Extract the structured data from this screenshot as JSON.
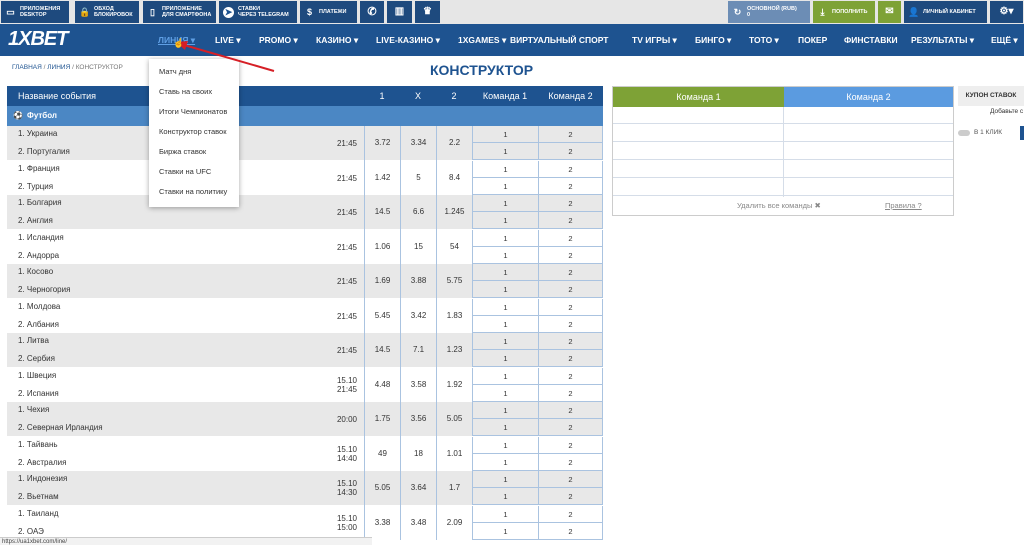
{
  "topbar": {
    "items": [
      {
        "label1": "ПРИЛОЖЕНИЯ",
        "label2": "DESKTOP",
        "icon": "monitor-icon"
      },
      {
        "label1": "ОБХОД",
        "label2": "БЛОКИРОВОК",
        "icon": "lock-icon"
      },
      {
        "label1": "ПРИЛОЖЕНИЕ",
        "label2": "ДЛЯ СМАРТФОНА",
        "icon": "phone-icon"
      },
      {
        "label1": "СТАВКИ",
        "label2": "ЧЕРЕЗ TELEGRAM",
        "icon": "telegram-icon"
      },
      {
        "label1": "ПЛАТЕЖИ",
        "label2": "",
        "icon": "dollar-icon"
      }
    ],
    "account_label": "ОСНОВНОЙ (RUB)",
    "account_value": "0",
    "deposit": "ПОПОЛНИТЬ",
    "cabinet": "ЛИЧНЫЙ КАБИНЕТ"
  },
  "nav": {
    "logo": "1XBET",
    "items": [
      "ЛИНИЯ",
      "LIVE",
      "PROMO",
      "КАЗИНО",
      "LIVE-КАЗИНО",
      "1XGAMES",
      "ВИРТУАЛЬНЫЙ СПОРТ",
      "TV ИГРЫ",
      "БИНГО",
      "ТОТО",
      "ПОКЕР",
      "ФИНСТАВКИ",
      "РЕЗУЛЬТАТЫ",
      "ЕЩЁ"
    ]
  },
  "breadcrumb": {
    "home": "ГЛАВНАЯ",
    "line": "ЛИНИЯ",
    "current": "КОНСТРУКТОР",
    "sep": "/"
  },
  "page_title": "КОНСТРУКТОР",
  "dropdown": [
    "Матч дня",
    "Ставь на своих",
    "Итоги Чемпионатов",
    "Конструктор ставок",
    "Биржа ставок",
    "Ставки на UFC",
    "Ставки на политику"
  ],
  "table": {
    "headers": [
      "Название события",
      "1",
      "X",
      "2",
      "Команда 1",
      "Команда 2"
    ],
    "sport": "Футбол",
    "rows": [
      {
        "t1": "1. Украина",
        "t2": "2. Португалия",
        "time": "21:45",
        "o1": "3.72",
        "x": "3.34",
        "o2": "2.2"
      },
      {
        "t1": "1. Франция",
        "t2": "2. Турция",
        "time": "21:45",
        "o1": "1.42",
        "x": "5",
        "o2": "8.4"
      },
      {
        "t1": "1. Болгария",
        "t2": "2. Англия",
        "time": "21:45",
        "o1": "14.5",
        "x": "6.6",
        "o2": "1.245"
      },
      {
        "t1": "1. Исландия",
        "t2": "2. Андорра",
        "time": "21:45",
        "o1": "1.06",
        "x": "15",
        "o2": "54"
      },
      {
        "t1": "1. Косово",
        "t2": "2. Черногория",
        "time": "21:45",
        "o1": "1.69",
        "x": "3.88",
        "o2": "5.75"
      },
      {
        "t1": "1. Молдова",
        "t2": "2. Албания",
        "time": "21:45",
        "o1": "5.45",
        "x": "3.42",
        "o2": "1.83"
      },
      {
        "t1": "1. Литва",
        "t2": "2. Сербия",
        "time": "21:45",
        "o1": "14.5",
        "x": "7.1",
        "o2": "1.23"
      },
      {
        "t1": "1. Швеция",
        "t2": "2. Испания",
        "time": "15.10 21:45",
        "o1": "4.48",
        "x": "3.58",
        "o2": "1.92"
      },
      {
        "t1": "1. Чехия",
        "t2": "2. Северная Ирландия",
        "time": "20:00",
        "o1": "1.75",
        "x": "3.56",
        "o2": "5.05"
      },
      {
        "t1": "1. Тайвань",
        "t2": "2. Австралия",
        "time": "15.10 14:40",
        "o1": "49",
        "x": "18",
        "o2": "1.01"
      },
      {
        "t1": "1. Индонезия",
        "t2": "2. Вьетнам",
        "time": "15.10 14:30",
        "o1": "5.05",
        "x": "3.64",
        "o2": "1.7"
      },
      {
        "t1": "1. Таиланд",
        "t2": "2. ОАЭ",
        "time": "15.10 15:00",
        "o1": "3.38",
        "x": "3.48",
        "o2": "2.09"
      }
    ],
    "btn1": "1",
    "btn2": "2"
  },
  "constructor": {
    "team1": "Команда 1",
    "team2": "Команда 2",
    "clear": "Удалить все команды ✖",
    "rules": "Правила ?"
  },
  "coupon": {
    "title": "КУПОН СТАВОК",
    "add": "Добавьте с",
    "oneclick": "В 1 КЛИК"
  },
  "status_url": "https://ua1xbet.com/line/",
  "colors": {
    "nav": "#1e5390",
    "team1": "#7ea236",
    "team2": "#5b9be0"
  }
}
